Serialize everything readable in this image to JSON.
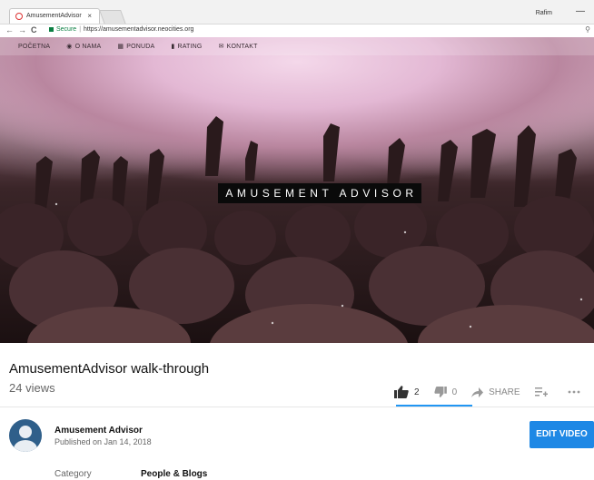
{
  "browser": {
    "tab_title": "AmusementAdvisor",
    "tab_close": "×",
    "user_label": "Rafim",
    "minimize": "—",
    "back": "←",
    "forward": "→",
    "reload": "C",
    "secure_label": "Secure",
    "url": "https://amusementadvisor.neocities.org",
    "zoom_icon": "search-icon"
  },
  "site_nav": {
    "items": [
      {
        "label": "POČETNA",
        "icon": ""
      },
      {
        "label": "O NAMA",
        "icon": "people-icon"
      },
      {
        "label": "PONUDA",
        "icon": "grid-icon"
      },
      {
        "label": "RATING",
        "icon": "document-icon"
      },
      {
        "label": "KONTAKT",
        "icon": "envelope-icon"
      }
    ]
  },
  "hero": {
    "title": "AMUSEMENT ADVISOR"
  },
  "video": {
    "title": "AmusementAdvisor walk-through",
    "views": "24 views",
    "likes": "2",
    "dislikes": "0",
    "share_label": "SHARE",
    "add_to_icon": "playlist-add-icon",
    "more_icon": "more-icon"
  },
  "channel": {
    "name": "Amusement Advisor",
    "published": "Published on Jan 14, 2018",
    "edit_button": "EDIT VIDEO"
  },
  "meta": {
    "category_label": "Category",
    "category_value": "People & Blogs"
  },
  "colors": {
    "accent": "#1e88e5",
    "like_underline": "#2196f3"
  }
}
